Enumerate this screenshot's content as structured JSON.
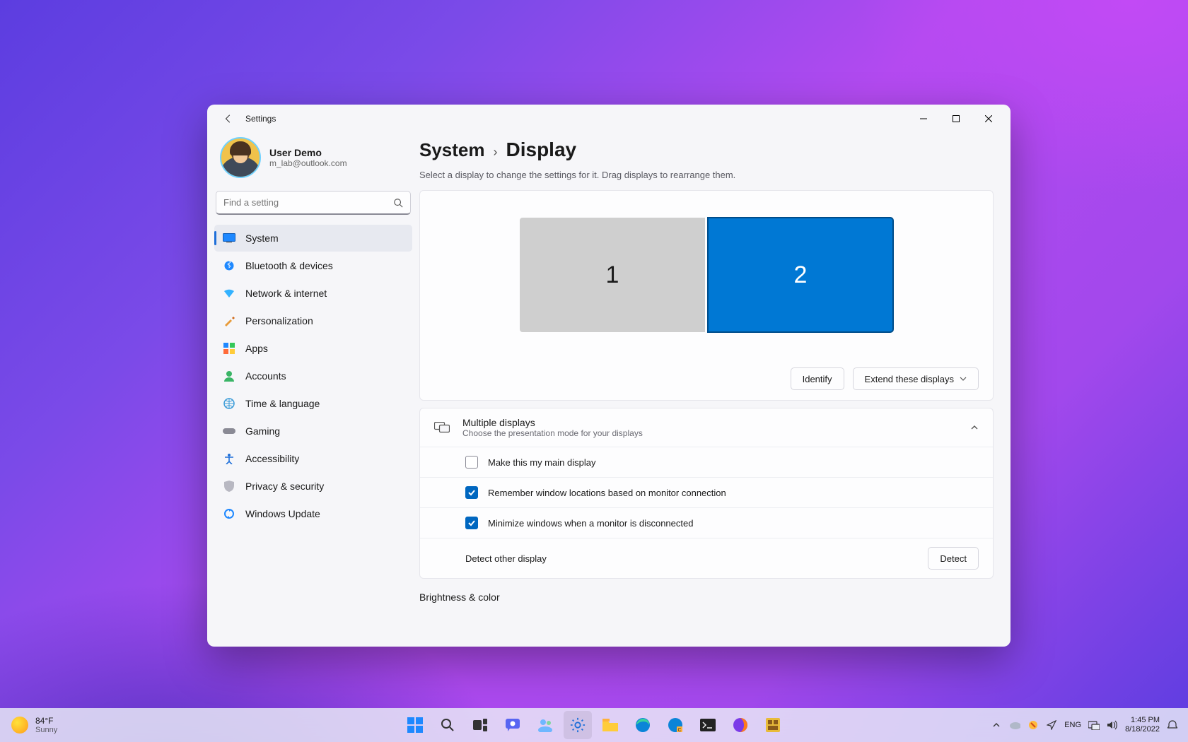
{
  "window": {
    "title": "Settings"
  },
  "user": {
    "name": "User Demo",
    "email": "m_lab@outlook.com"
  },
  "search": {
    "placeholder": "Find a setting"
  },
  "nav": {
    "items": [
      {
        "label": "System"
      },
      {
        "label": "Bluetooth & devices"
      },
      {
        "label": "Network & internet"
      },
      {
        "label": "Personalization"
      },
      {
        "label": "Apps"
      },
      {
        "label": "Accounts"
      },
      {
        "label": "Time & language"
      },
      {
        "label": "Gaming"
      },
      {
        "label": "Accessibility"
      },
      {
        "label": "Privacy & security"
      },
      {
        "label": "Windows Update"
      }
    ],
    "active_index": 0
  },
  "breadcrumb": {
    "parent": "System",
    "current": "Display"
  },
  "subtext": "Select a display to change the settings for it. Drag displays to rearrange them.",
  "arrange": {
    "monitors": [
      {
        "id": "1"
      },
      {
        "id": "2"
      }
    ],
    "selected_index": 1,
    "identify_label": "Identify",
    "mode_label": "Extend these displays"
  },
  "multidisplay": {
    "title": "Multiple displays",
    "subtitle": "Choose the presentation mode for your displays",
    "rows": [
      {
        "label": "Make this my main display",
        "checked": false
      },
      {
        "label": "Remember window locations based on monitor connection",
        "checked": true
      },
      {
        "label": "Minimize windows when a monitor is disconnected",
        "checked": true
      }
    ],
    "detect_label": "Detect other display",
    "detect_button": "Detect"
  },
  "section_brightness": "Brightness & color",
  "taskbar": {
    "weather_temp": "84°F",
    "weather_desc": "Sunny",
    "language": "ENG",
    "time": "1:45 PM",
    "date": "8/18/2022"
  }
}
